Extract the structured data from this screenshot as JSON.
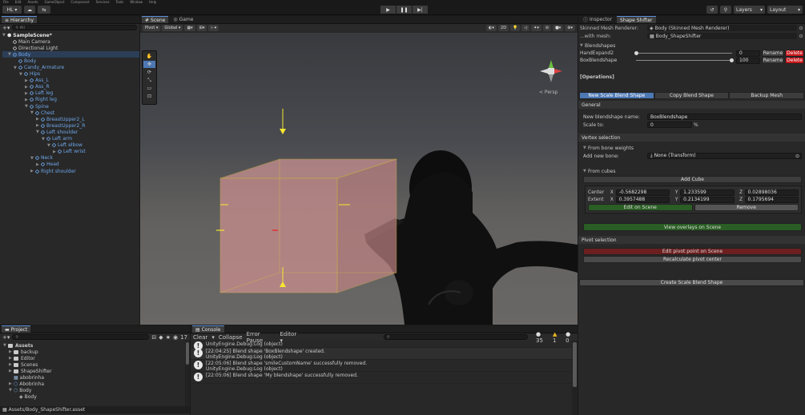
{
  "menu": [
    "File",
    "Edit",
    "Assets",
    "GameObject",
    "Component",
    "Services",
    "Tools",
    "Window",
    "Help"
  ],
  "toolbar": {
    "account": "HL ▾",
    "cloud_icon": "cloud-icon",
    "collab_icon": "collab-icon",
    "play_icon": "▶",
    "pause_icon": "❚❚",
    "step_icon": "▶|",
    "history_icon": "↺",
    "search_icon": "⚲",
    "layers": "Layers",
    "layout": "Layout"
  },
  "hierarchy": {
    "tab": "Hierarchy",
    "search": "All",
    "scene": "SampleScene*",
    "items": [
      {
        "label": "Main Camera",
        "indent": 1,
        "blue": false,
        "arrow": ""
      },
      {
        "label": "Directional Light",
        "indent": 1,
        "blue": false,
        "arrow": ""
      },
      {
        "label": "Body",
        "indent": 1,
        "blue": true,
        "arrow": "▼"
      },
      {
        "label": "Body",
        "indent": 2,
        "blue": true,
        "arrow": ""
      },
      {
        "label": "Candy_Armature",
        "indent": 2,
        "blue": true,
        "arrow": "▼"
      },
      {
        "label": "Hips",
        "indent": 3,
        "blue": true,
        "arrow": "▼"
      },
      {
        "label": "Ass_L",
        "indent": 4,
        "blue": true,
        "arrow": "▶"
      },
      {
        "label": "Ass_R",
        "indent": 4,
        "blue": true,
        "arrow": "▶"
      },
      {
        "label": "Left leg",
        "indent": 4,
        "blue": true,
        "arrow": "▶"
      },
      {
        "label": "Right leg",
        "indent": 4,
        "blue": true,
        "arrow": "▶"
      },
      {
        "label": "Spine",
        "indent": 4,
        "blue": true,
        "arrow": "▼"
      },
      {
        "label": "Chest",
        "indent": 5,
        "blue": true,
        "arrow": "▼"
      },
      {
        "label": "BreastUpper2_L",
        "indent": 6,
        "blue": true,
        "arrow": "▶"
      },
      {
        "label": "BreastUpper2_R",
        "indent": 6,
        "blue": true,
        "arrow": "▶"
      },
      {
        "label": "Left shoulder",
        "indent": 6,
        "blue": true,
        "arrow": "▼"
      },
      {
        "label": "Left arm",
        "indent": 7,
        "blue": true,
        "arrow": "▼"
      },
      {
        "label": "Left elbow",
        "indent": 8,
        "blue": true,
        "arrow": "▼"
      },
      {
        "label": "Left wrist",
        "indent": 9,
        "blue": true,
        "arrow": "▶"
      },
      {
        "label": "Neck",
        "indent": 5,
        "blue": true,
        "arrow": "▼"
      },
      {
        "label": "Head",
        "indent": 6,
        "blue": true,
        "arrow": "▶"
      },
      {
        "label": "Right shoulder",
        "indent": 5,
        "blue": true,
        "arrow": "▶"
      }
    ]
  },
  "scene": {
    "tab_scene": "Scene",
    "tab_game": "Game",
    "pivot": "Pivot ▾",
    "global": "Global ▾",
    "view_2d": "2D",
    "persp": "< Persp"
  },
  "inspector": {
    "tab_inspector": "Inspector",
    "tab_shape": "Shape Shifter",
    "smr_label": "Skinned Mesh Renderer:",
    "smr_value": "Body (Skinned Mesh Renderer)",
    "mesh_label": "...with mesh:",
    "mesh_value": "Body_ShapeShifter",
    "blendshapes_title": "Blendshapes",
    "blendshapes": [
      {
        "name": "HandExpand2",
        "value": "0",
        "fraction": 0
      },
      {
        "name": "BoxBlendshape",
        "value": "100",
        "fraction": 1
      }
    ],
    "rename": "Rename",
    "delete": "Delete",
    "operations": "[Operations]",
    "op_tabs": [
      "New Scale Blend Shape",
      "Copy Blend Shape",
      "Backup Mesh"
    ],
    "general": "General",
    "new_name_label": "New blendshape name:",
    "new_name_value": "BoxBlendshape",
    "scale_label": "Scale to:",
    "scale_value": "0",
    "scale_unit": "%",
    "vertex_selection": "Vertex selection",
    "from_bone": "From bone weights",
    "add_bone_label": "Add new bone:",
    "add_bone_value": "None (Transform)",
    "from_cubes": "From cubes",
    "add_cube": "Add Cube",
    "center_label": "Center",
    "extent_label": "Extent",
    "center": {
      "x": "-0.5682298",
      "y": "1.233599",
      "z": "0.02898036"
    },
    "extent": {
      "x": "0.3957488",
      "y": "0.2134199",
      "z": "0.1795694"
    },
    "axis_x": "X",
    "axis_y": "Y",
    "axis_z": "Z",
    "edit_on_scene": "Edit on Scene",
    "remove": "Remove",
    "view_overlays": "View overlays on Scene",
    "pivot_selection": "Pivot selection",
    "edit_pivot": "Edit pivot point on Scene",
    "recalc_pivot": "Recalculate pivot center",
    "create": "Create Scale Blend Shape"
  },
  "project": {
    "tab": "Project",
    "hidden_count": "17",
    "items": [
      {
        "label": "Assets",
        "indent": 0,
        "arrow": "▼",
        "type": "folder",
        "bold": true
      },
      {
        "label": "backup",
        "indent": 1,
        "arrow": "▶",
        "type": "folder",
        "bold": false
      },
      {
        "label": "Editor",
        "indent": 1,
        "arrow": "▶",
        "type": "folder",
        "bold": false
      },
      {
        "label": "Scenes",
        "indent": 1,
        "arrow": "▶",
        "type": "folder",
        "bold": false
      },
      {
        "label": "ShapeShifter",
        "indent": 1,
        "arrow": "▶",
        "type": "folder",
        "bold": false
      },
      {
        "label": "abobrinha",
        "indent": 1,
        "arrow": "",
        "type": "asset",
        "bold": false
      },
      {
        "label": "Abobrinha",
        "indent": 1,
        "arrow": "▶",
        "type": "prefab",
        "bold": false
      },
      {
        "label": "Body",
        "indent": 1,
        "arrow": "▼",
        "type": "prefab",
        "bold": false
      },
      {
        "label": "Body",
        "indent": 2,
        "arrow": "",
        "type": "mesh",
        "bold": false
      }
    ],
    "path": "Assets/Body_ShapeShifter.asset"
  },
  "console": {
    "tab": "Console",
    "clear": "Clear",
    "collapse": "Collapse",
    "error_pause": "Error Pause",
    "editor": "Editor ▾",
    "count_info": "35",
    "count_warn": "1",
    "count_error": "0",
    "entries": [
      {
        "line1": "",
        "line2": "UnityEngine.Debug:Log (object)"
      },
      {
        "line1": "[22:04:25] Blend shape 'BoxBlendshape' created.",
        "line2": "UnityEngine.Debug:Log (object)"
      },
      {
        "line1": "[22:05:06] Blend shape 'smileCustomName' successfully removed.",
        "line2": "UnityEngine.Debug:Log (object)"
      },
      {
        "line1": "[22:05:06] Blend shape 'My blendshape' successfully removed.",
        "line2": ""
      }
    ]
  },
  "colors": {
    "accent_blue": "#4d78b3",
    "green_button": "#2a5e24",
    "red_button": "#6b1f1f",
    "delete_red": "#c7171b",
    "selection_box": "#e0c040"
  }
}
